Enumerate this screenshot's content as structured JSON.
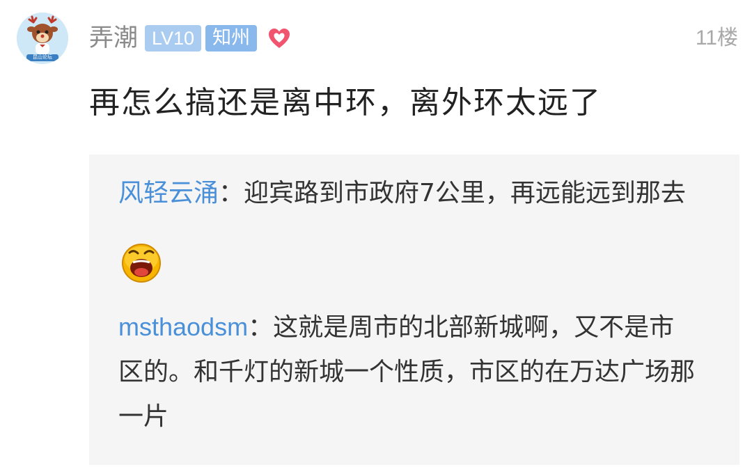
{
  "user": {
    "name": "弄潮",
    "level": "LV10",
    "location": "知州",
    "avatar_icon": "deer-mascot-icon",
    "avatar_caption": "昆山论坛",
    "heart_icon": "heart-icon"
  },
  "post": {
    "floor": "11楼",
    "content": "再怎么搞还是离中环，离外环太远了"
  },
  "quotes": [
    {
      "author": "风轻云涌",
      "separator": "：",
      "text": "迎宾路到市政府7公里，再远能远到那去",
      "emoji": "laughing-face-emoji"
    },
    {
      "author": "msthaodsm",
      "separator": "：",
      "text": "这就是周市的北部新城啊，又不是市区的。和千灯的新城一个性质，市区的在万达广场那一片"
    }
  ],
  "colors": {
    "author_link": "#4a90d9",
    "badge_level": "#a9ccf0",
    "badge_location": "#89b8ec",
    "heart": "#f0546e",
    "quote_background": "#f5f5f5"
  }
}
